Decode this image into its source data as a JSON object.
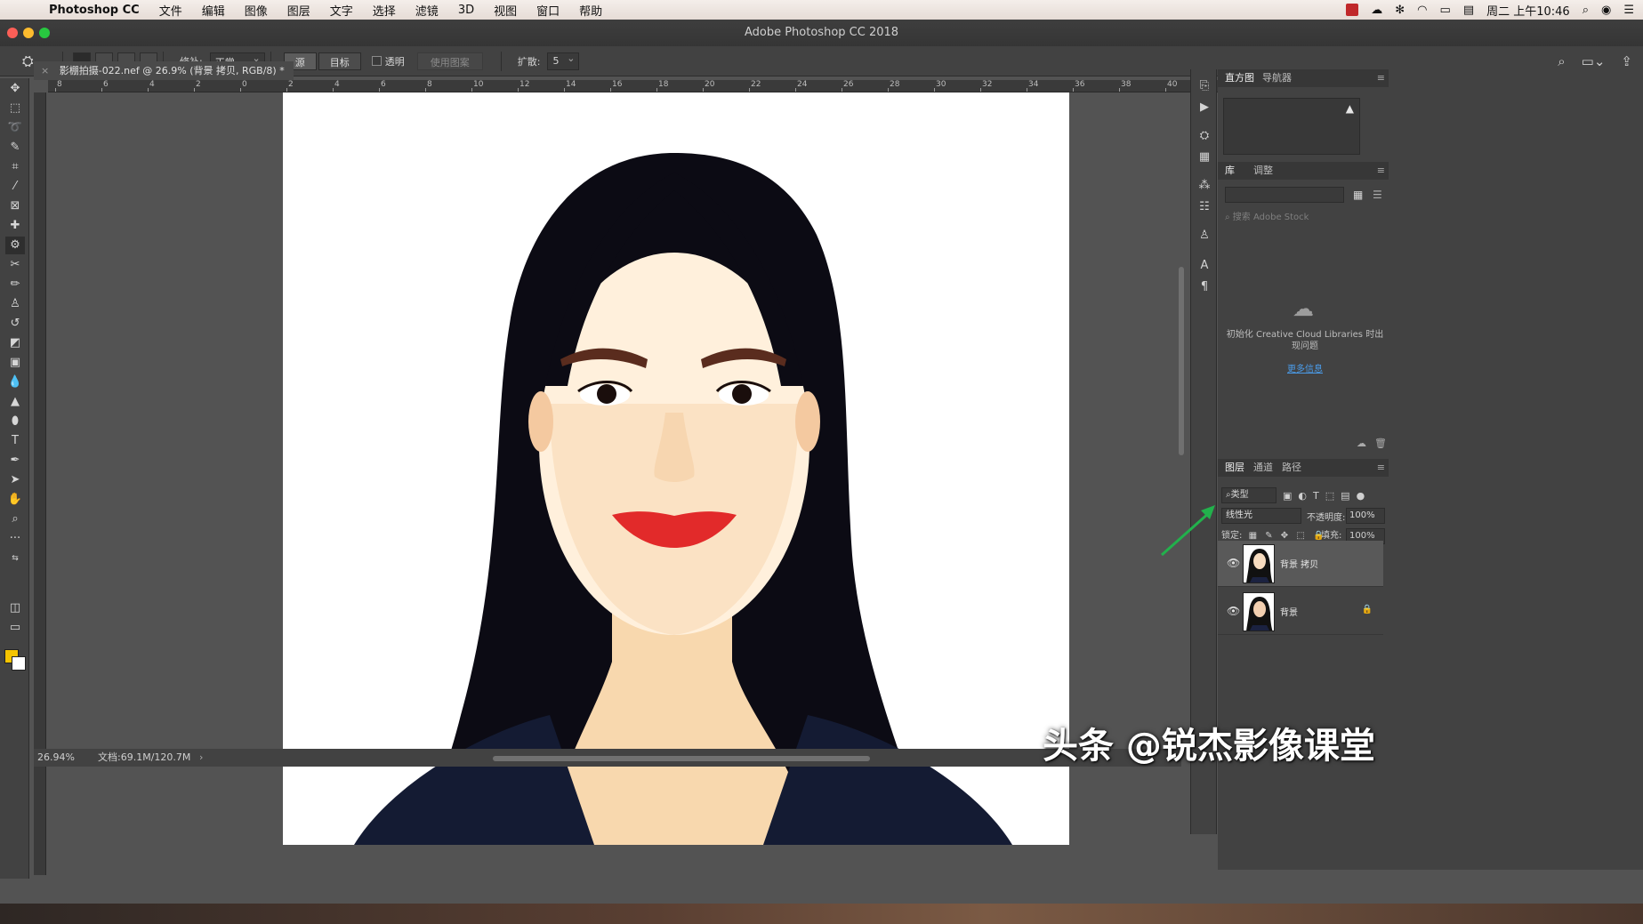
{
  "menubar": {
    "app": "Photoshop CC",
    "items": [
      "文件",
      "编辑",
      "图像",
      "图层",
      "文字",
      "选择",
      "滤镜",
      "3D",
      "视图",
      "窗口",
      "帮助"
    ],
    "clock": "周二 上午10:46"
  },
  "window": {
    "title": "Adobe Photoshop CC 2018"
  },
  "options": {
    "blend_label": "修补:",
    "blend_value": "正常",
    "source": "源",
    "target": "目标",
    "transparent": "透明",
    "use_pattern": "使用图案",
    "diffusion_label": "扩散:",
    "diffusion_value": "5"
  },
  "document": {
    "tab_title": "影棚拍摄-022.nef @ 26.9% (背景 拷贝, RGB/8) *",
    "zoom": "26.94%",
    "doc_size": "文档:69.1M/120.7M"
  },
  "ruler": {
    "h_labels": [
      "8",
      "6",
      "4",
      "2",
      "0",
      "2",
      "4",
      "6",
      "8",
      "10",
      "12",
      "14",
      "16",
      "18",
      "20",
      "22",
      "24",
      "26",
      "28",
      "30",
      "32",
      "34",
      "36",
      "38",
      "40"
    ]
  },
  "panels": {
    "histogram_tabs": [
      "直方图",
      "导航器"
    ],
    "library_tabs": [
      "库",
      "调整"
    ],
    "search_placeholder": "搜索 Adobe Stock",
    "cc_message": "初始化 Creative Cloud Libraries 时出现问题",
    "cc_link": "更多信息",
    "layers_tabs": [
      "图层",
      "通道",
      "路径"
    ],
    "kind_filter": "类型",
    "blend_mode": "线性光",
    "opacity_label": "不透明度:",
    "opacity_value": "100%",
    "lock_label": "锁定:",
    "fill_label": "填充:",
    "fill_value": "100%",
    "layers": [
      {
        "name": "背景 拷贝",
        "visible": true,
        "selected": true,
        "locked": false
      },
      {
        "name": "背景",
        "visible": true,
        "selected": false,
        "locked": true
      }
    ]
  },
  "colors": {
    "foreground": "#f5c400",
    "background": "#ffffff",
    "link": "#4a9be8",
    "annotation_arrow": "#22b14c"
  },
  "watermark": "头条 @锐杰影像课堂"
}
